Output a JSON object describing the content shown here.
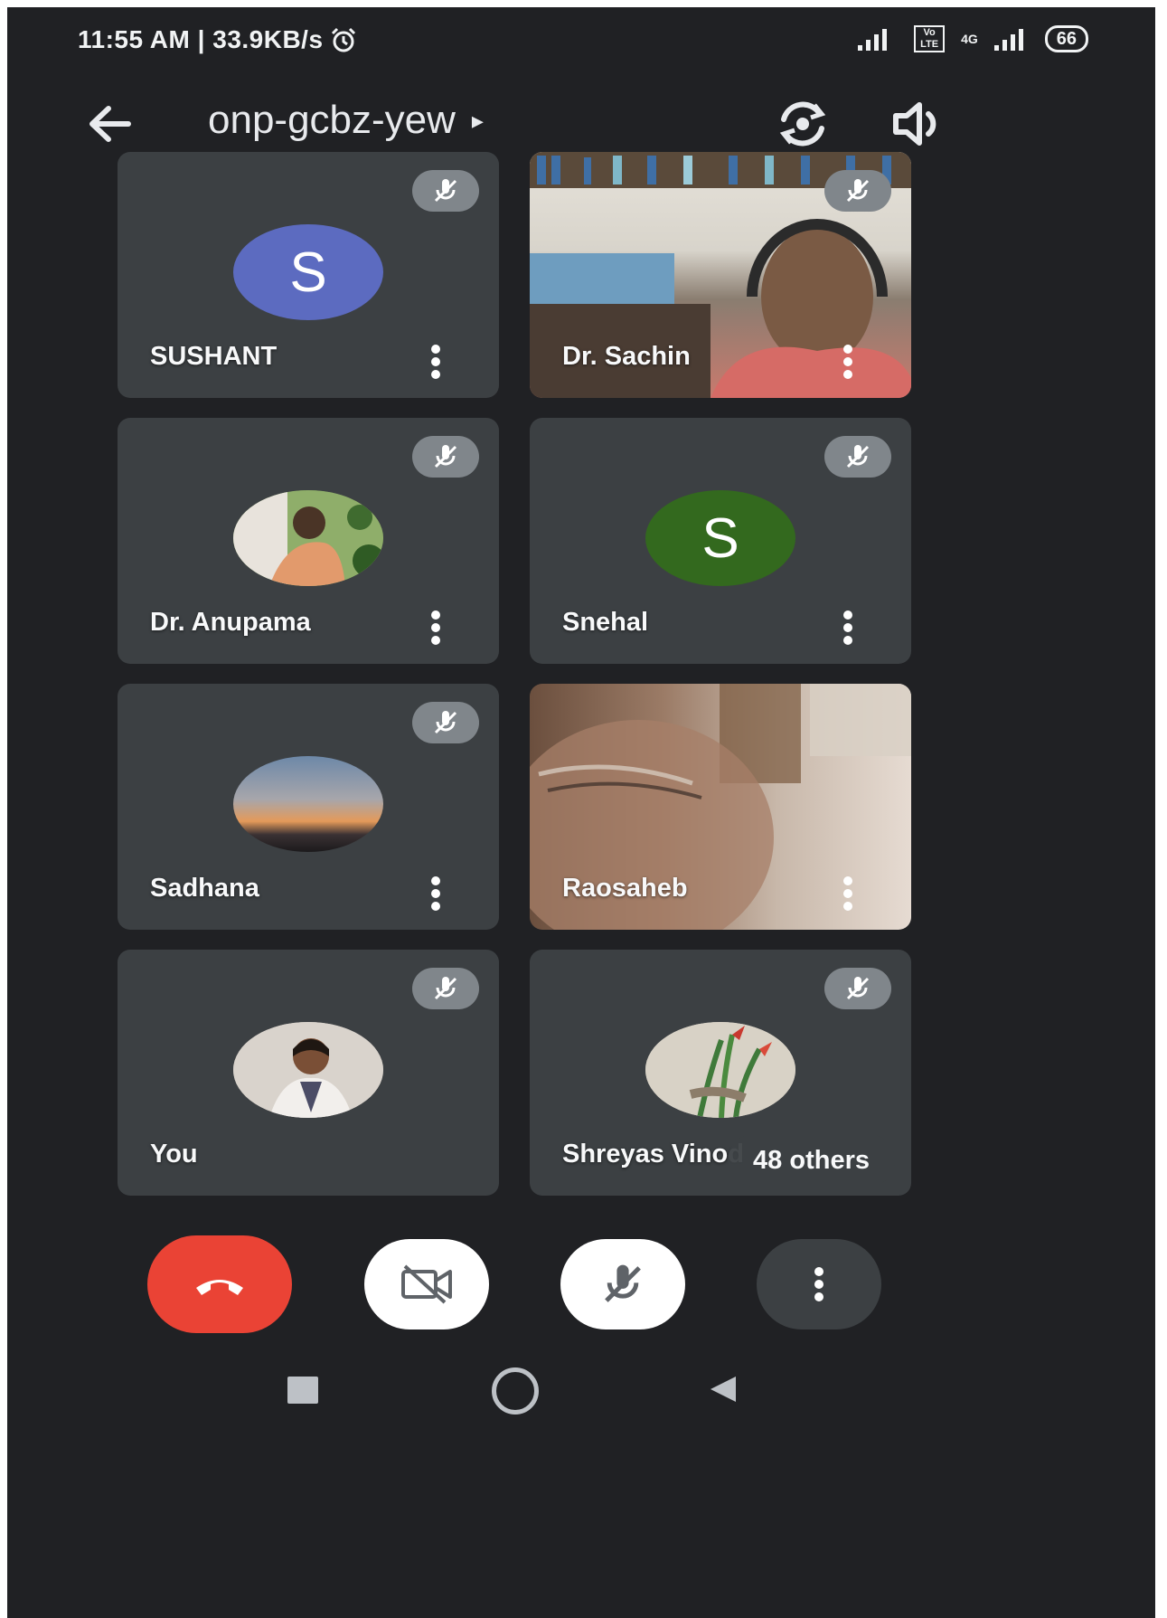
{
  "status": {
    "time_speed": "11:55 AM | 33.9KB/s",
    "volte": "Vo LTE",
    "net": "4G",
    "battery": "66"
  },
  "header": {
    "meeting_code": "onp-gcbz-yew",
    "expand_arrow": "▸"
  },
  "participants": [
    {
      "name": "SUSHANT",
      "letter": "S",
      "avatar_color": "#5c6bc0"
    },
    {
      "name": "Dr. Sachin"
    },
    {
      "name": "Dr. Anupama"
    },
    {
      "name": "Snehal",
      "letter": "S",
      "avatar_color": "#33691e"
    },
    {
      "name": "Sadhana"
    },
    {
      "name": "Raosaheb"
    },
    {
      "name": "You"
    },
    {
      "name": "Shreyas Vinod"
    }
  ],
  "others_badge": "48 others",
  "colors": {
    "background": "#202124",
    "tile": "#3c4043",
    "end_call": "#ea4335",
    "muted_badge": "#80868b"
  },
  "icons": {
    "back": "arrow-left-icon",
    "switch_camera": "switch-camera-icon",
    "speaker": "speaker-icon",
    "muted": "mic-off-icon",
    "more": "more-vertical-icon",
    "end_call": "phone-hangup-icon",
    "camera_off": "video-off-icon",
    "mic_off": "mic-off-icon"
  }
}
